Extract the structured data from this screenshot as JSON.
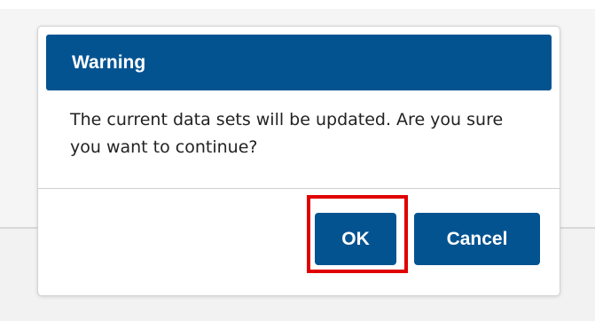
{
  "dialog": {
    "title": "Warning",
    "message": "The current data sets will be updated. Are you sure you want to continue?",
    "buttons": {
      "ok_label": "OK",
      "cancel_label": "Cancel"
    }
  },
  "colors": {
    "header_background": "#045391",
    "button_background": "#045391",
    "button_text": "#ffffff",
    "highlight_border": "#e00000",
    "page_background": "#f2f2f2"
  },
  "annotations": {
    "highlighted_element": "ok-button"
  }
}
